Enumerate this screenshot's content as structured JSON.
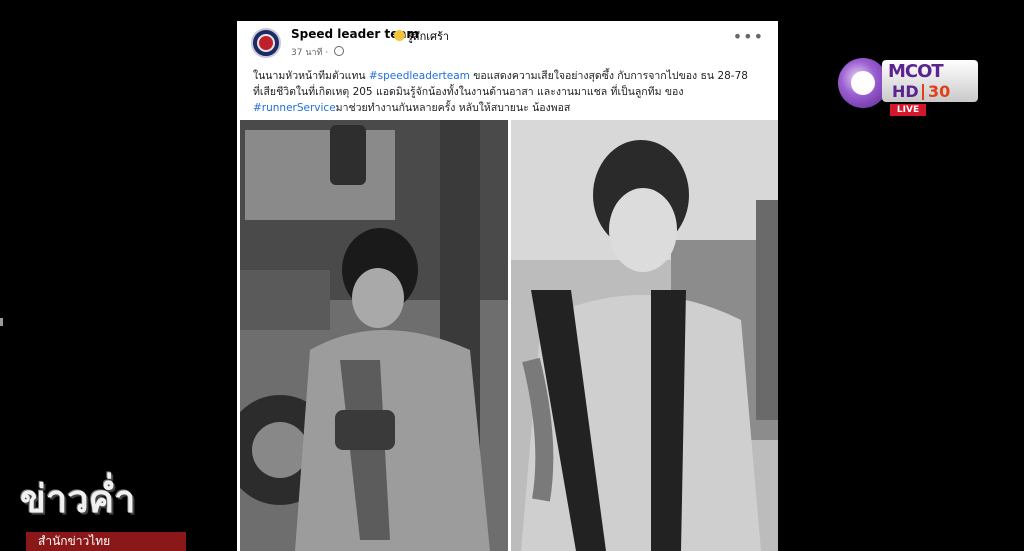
{
  "post": {
    "page_name": "Speed leader team",
    "feeling": "รู้สึกเศร้า",
    "time": "37 นาที",
    "more_label": "•••",
    "caption": {
      "part1": "ในนามหัวหน้าทีมตัวแทน ",
      "hashtag1": "#speedleaderteam",
      "part2": " ขอแสดงความเสียใจอย่างสุดซึ้ง กับการจากไปของ ธน 28-78 ที่เสียชีวิตในที่เกิดเหตุ 205 แอดมินรู้จักน้องทั้งในงานด้านอาสา และงานมาแชล ที่เป็นลูกทีม ของ ",
      "hashtag2": "#runnerService",
      "part3": "มาช่วยทำงานกันหลายครั้ง หลับให้สบายนะ น้องพอส"
    }
  },
  "channel_logo": {
    "brand": "MCOT",
    "hd": "HD",
    "number": "30",
    "live": "LIVE"
  },
  "news_logo": {
    "title": "ข่าวค่ำ",
    "subtitle": "สำนักข่าวไทย"
  },
  "colors": {
    "hashtag": "#216fdb",
    "live_red": "#d3182b",
    "news_red": "#8a1818",
    "mcot_purple": "#5a2391"
  }
}
